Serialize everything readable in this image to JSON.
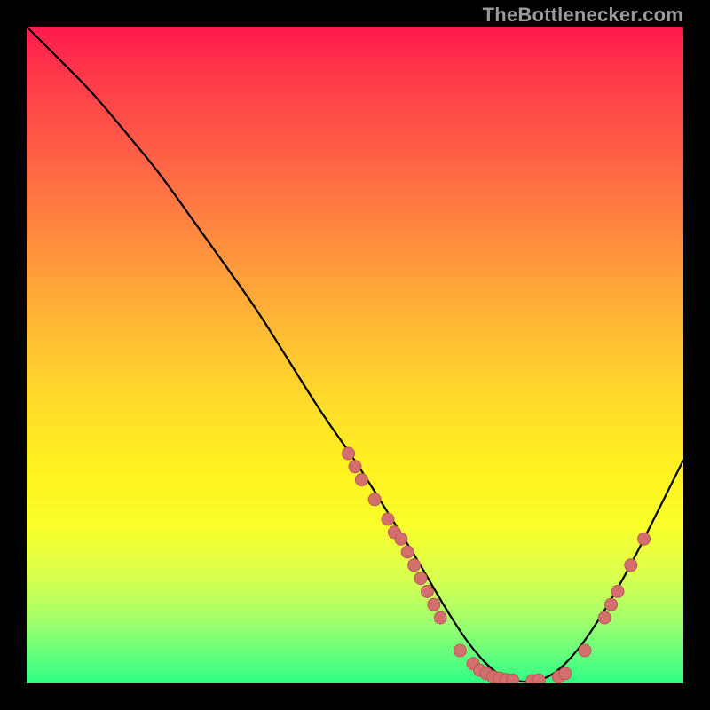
{
  "watermark": {
    "text": "TheBottlenecker.com"
  },
  "colors": {
    "background_outer": "#000000",
    "curve_stroke": "#000000",
    "marker_fill": "#d36f6c",
    "marker_stroke": "#b85a57",
    "gradient_stops": [
      "#ff1a4d",
      "#ff3a4a",
      "#ff5b47",
      "#ff7d42",
      "#ff9f3b",
      "#ffc033",
      "#ffde2a",
      "#fff220",
      "#f9ff2a",
      "#d8ff50",
      "#a6ff6b",
      "#6bff7b",
      "#2fff86"
    ]
  },
  "chart_data": {
    "type": "line",
    "title": "",
    "xlabel": "",
    "ylabel": "",
    "xlim": [
      0,
      100
    ],
    "ylim": [
      0,
      100
    ],
    "grid": false,
    "legend": false,
    "series": [
      {
        "name": "bottleneck-curve",
        "x": [
          0,
          5,
          10,
          15,
          20,
          25,
          30,
          35,
          40,
          45,
          50,
          55,
          60,
          64,
          68,
          72,
          76,
          80,
          84,
          88,
          92,
          96,
          100
        ],
        "y": [
          100,
          95,
          90,
          84,
          78,
          71,
          64,
          57,
          49,
          41,
          34,
          26,
          18,
          11,
          5,
          1,
          0,
          1,
          5,
          11,
          18,
          26,
          34
        ]
      }
    ],
    "markers": [
      {
        "x": 49,
        "y": 35
      },
      {
        "x": 50,
        "y": 33
      },
      {
        "x": 51,
        "y": 31
      },
      {
        "x": 53,
        "y": 28
      },
      {
        "x": 55,
        "y": 25
      },
      {
        "x": 56,
        "y": 23
      },
      {
        "x": 57,
        "y": 22
      },
      {
        "x": 58,
        "y": 20
      },
      {
        "x": 59,
        "y": 18
      },
      {
        "x": 60,
        "y": 16
      },
      {
        "x": 61,
        "y": 14
      },
      {
        "x": 62,
        "y": 12
      },
      {
        "x": 63,
        "y": 10
      },
      {
        "x": 66,
        "y": 5
      },
      {
        "x": 68,
        "y": 3
      },
      {
        "x": 69,
        "y": 2
      },
      {
        "x": 70,
        "y": 1.5
      },
      {
        "x": 71,
        "y": 1
      },
      {
        "x": 72,
        "y": 0.8
      },
      {
        "x": 73,
        "y": 0.6
      },
      {
        "x": 74,
        "y": 0.5
      },
      {
        "x": 77,
        "y": 0.4
      },
      {
        "x": 78,
        "y": 0.5
      },
      {
        "x": 81,
        "y": 1
      },
      {
        "x": 82,
        "y": 1.5
      },
      {
        "x": 85,
        "y": 5
      },
      {
        "x": 88,
        "y": 10
      },
      {
        "x": 89,
        "y": 12
      },
      {
        "x": 90,
        "y": 14
      },
      {
        "x": 92,
        "y": 18
      },
      {
        "x": 94,
        "y": 22
      }
    ]
  }
}
